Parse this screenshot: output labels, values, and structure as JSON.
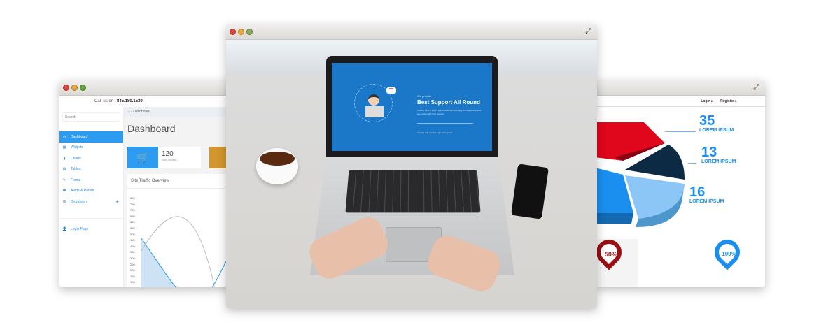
{
  "left_window": {
    "call_label": "Call-us on :",
    "phone": "845.180.1530",
    "search_placeholder": "Search",
    "nav": [
      {
        "label": "Dashboard",
        "icon": "◷"
      },
      {
        "label": "Widgets",
        "icon": "▦"
      },
      {
        "label": "Charts",
        "icon": "▮"
      },
      {
        "label": "Tables",
        "icon": "▤"
      },
      {
        "label": "Forms",
        "icon": "✎"
      },
      {
        "label": "Alerts & Panels",
        "icon": "❶"
      },
      {
        "label": "Dropdown",
        "icon": "☰"
      }
    ],
    "dropdown_plus": "+",
    "login_page": "Login Page",
    "login_icon": "👤",
    "breadcrumb": "Dashboard",
    "title": "Dashboard",
    "orders_count": "120",
    "orders_label": "New Orders",
    "traffic_title": "Site Traffic Overview",
    "y_ticks": [
      "800",
      "750",
      "700",
      "650",
      "600",
      "550",
      "500",
      "450",
      "400",
      "350",
      "300",
      "250",
      "200",
      "150",
      "100"
    ]
  },
  "center_window": {
    "screen": {
      "we_provide": "We provide",
      "headline": "Best Support All Round",
      "description": "Choose MULTI HOST with confidence and enjoy the trusted services we provide with high security.",
      "trusted": "Trusted with multiple high class giants"
    }
  },
  "right_window": {
    "login": "Login ▸",
    "register": "Register ▸",
    "stats": [
      {
        "value": "35",
        "label": "LOREM IPSUM"
      },
      {
        "value": "13",
        "label": "LOREM IPSUM"
      },
      {
        "value": "16",
        "label": "LOREM IPSUM"
      }
    ],
    "pins": [
      {
        "value": "50%",
        "color": "#9b0f12"
      },
      {
        "value": "100%",
        "color": "#1a8ff0"
      }
    ]
  }
}
